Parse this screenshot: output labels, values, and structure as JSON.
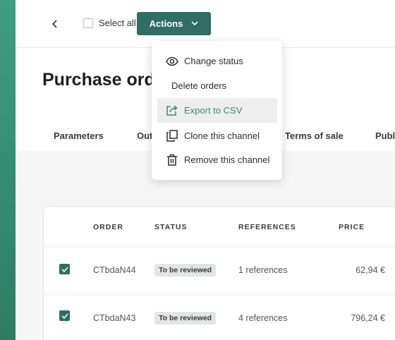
{
  "colors": {
    "brand": "#2f6e60",
    "accent_green": "#3a8a74",
    "left_bar": "#3f9e80"
  },
  "toolbar": {
    "back_icon": "chevron-left-icon",
    "select_all_label": "Select all",
    "actions_label": "Actions",
    "actions_icon": "chevron-down-icon"
  },
  "page": {
    "title": "Purchase orders",
    "tabs": [
      "Parameters",
      "Out",
      "Terms of sale",
      "Publi"
    ]
  },
  "actions_menu": {
    "items": [
      {
        "label": "Change status",
        "icon": "eye-icon"
      },
      {
        "label": "Delete orders",
        "icon": ""
      },
      {
        "label": "Export to CSV",
        "icon": "export-icon"
      },
      {
        "label": "Clone this channel",
        "icon": "copy-icon"
      },
      {
        "label": "Remove this channel",
        "icon": "trash-icon"
      }
    ]
  },
  "table": {
    "headers": [
      "ORDER",
      "STATUS",
      "REFERENCES",
      "PRICE"
    ],
    "rows": [
      {
        "checked": true,
        "order": "CTbdaN44",
        "status": "To be reviewed",
        "references": "1 references",
        "price": "62,94 €"
      },
      {
        "checked": true,
        "order": "CTbdaN43",
        "status": "To be reviewed",
        "references": "4 references",
        "price": "796,24 €"
      }
    ]
  }
}
